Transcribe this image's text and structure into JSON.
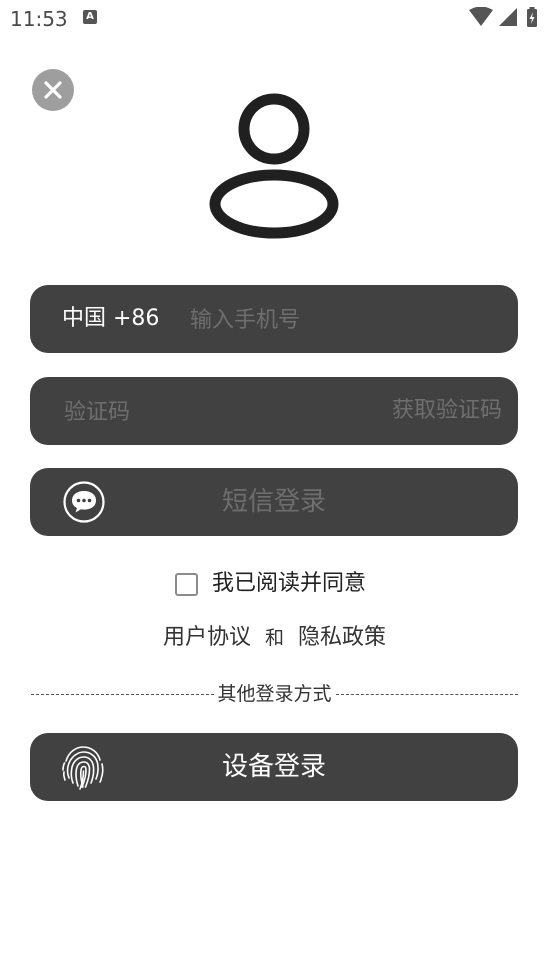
{
  "status_bar": {
    "time": "11:53",
    "notification_icon": "A"
  },
  "login": {
    "country_code": "中国 +86",
    "phone_placeholder": "输入手机号",
    "code_placeholder": "验证码",
    "get_code_label": "获取验证码",
    "sms_login_label": "短信登录",
    "agreement_text": "我已阅读并同意",
    "user_agreement": "用户协议",
    "and_text": "和",
    "privacy_policy": "隐私政策",
    "other_methods": "其他登录方式",
    "device_login_label": "设备登录"
  },
  "icons": [
    "close-icon",
    "user-avatar-icon",
    "chat-bubble-icon",
    "fingerprint-icon",
    "wifi-icon",
    "signal-icon",
    "battery-icon"
  ],
  "colors": {
    "pill_bg": "#414141",
    "placeholder": "#6e6e6e",
    "close_bg": "#9e9e9e"
  }
}
